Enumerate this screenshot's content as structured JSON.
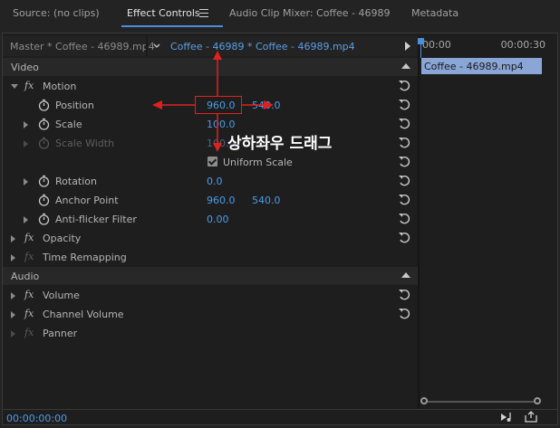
{
  "tabs": {
    "source": "Source: (no clips)",
    "effect_controls": "Effect Controls",
    "audio_mixer": "Audio Clip Mixer: Coffee - 46989",
    "metadata": "Metadata"
  },
  "clip_header": {
    "master": "Master * Coffee - 46989.mp4",
    "current": "Coffee - 46989 * Coffee - 46989.mp4"
  },
  "timeline": {
    "start": "00:00",
    "end": "00:00:30",
    "clip_name": "Coffee - 46989.mp4"
  },
  "sections": {
    "video": "Video",
    "audio": "Audio"
  },
  "motion": {
    "label": "Motion",
    "position": {
      "label": "Position",
      "x": "960.0",
      "y": "540.0"
    },
    "scale": {
      "label": "Scale",
      "value": "100.0"
    },
    "scale_width": {
      "label": "Scale Width",
      "value": "100.0"
    },
    "uniform_scale": {
      "label": "Uniform Scale",
      "checked": true
    },
    "rotation": {
      "label": "Rotation",
      "value": "0.0"
    },
    "anchor_point": {
      "label": "Anchor Point",
      "x": "960.0",
      "y": "540.0"
    },
    "anti_flicker": {
      "label": "Anti-flicker Filter",
      "value": "0.00"
    }
  },
  "effects": {
    "opacity": "Opacity",
    "time_remapping": "Time Remapping",
    "volume": "Volume",
    "channel_volume": "Channel Volume",
    "panner": "Panner"
  },
  "footer": {
    "timecode": "00:00:00:00"
  },
  "annotation": {
    "text": "상하좌우 드래그"
  },
  "colors": {
    "accent": "#4d9be8",
    "annotation": "#e02020",
    "clip": "#8aa6d6"
  }
}
